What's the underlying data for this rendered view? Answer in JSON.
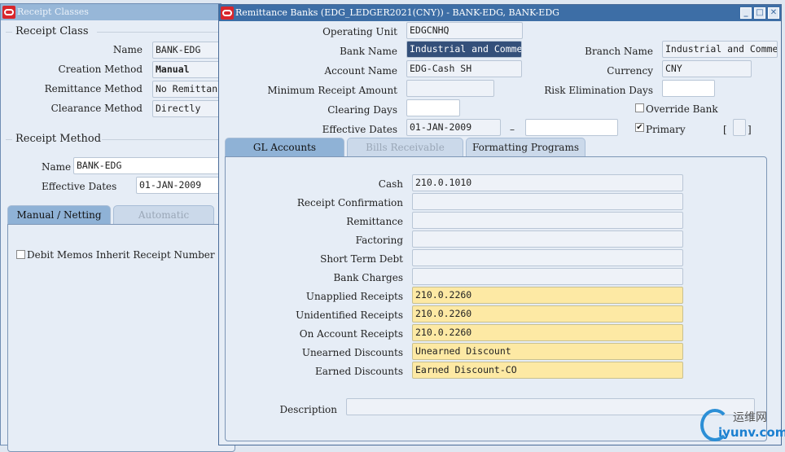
{
  "left": {
    "title": "Receipt Classes",
    "receipt_class_group": "Receipt Class",
    "name_label": "Name",
    "name_value": "BANK-EDG",
    "creation_label": "Creation Method",
    "creation_value": "Manual",
    "remit_label": "Remittance Method",
    "remit_value": "No Remittan",
    "clear_label": "Clearance Method",
    "clear_value": "Directly",
    "receipt_method_group": "Receipt Method",
    "rm_name_label": "Name",
    "rm_name_value": "BANK-EDG",
    "rm_dates_label": "Effective Dates",
    "rm_date_from": "01-JAN-2009",
    "tabs": [
      "Manual / Netting",
      "Automatic"
    ],
    "debit_memos_label": "Debit Memos Inherit Receipt Number"
  },
  "right": {
    "title": "Remittance Banks (EDG_LEDGER2021(CNY)) - BANK-EDG, BANK-EDG",
    "operating_unit_label": "Operating Unit",
    "operating_unit": "EDGCNHQ",
    "bank_name_label": "Bank Name",
    "bank_name": "Industrial and Comme",
    "branch_name_label": "Branch Name",
    "branch_name": "Industrial and Comme",
    "account_name_label": "Account Name",
    "account_name": "EDG-Cash SH",
    "currency_label": "Currency",
    "currency": "CNY",
    "min_receipt_label": "Minimum Receipt Amount",
    "min_receipt": "",
    "risk_days_label": "Risk Elimination Days",
    "risk_days": "",
    "clearing_days_label": "Clearing Days",
    "clearing_days": "",
    "override_bank_label": "Override Bank",
    "override_bank_checked": false,
    "eff_dates_label": "Effective Dates",
    "eff_from": "01-JAN-2009",
    "eff_sep": "–",
    "eff_to": "",
    "primary_label": "Primary",
    "primary_checked": true,
    "bracket_open": "[",
    "bracket_close": "]",
    "tabs": [
      "GL Accounts",
      "Bills Receivable",
      "Formatting Programs"
    ],
    "gl": [
      {
        "label": "Cash",
        "value": "210.0.1010",
        "req": false
      },
      {
        "label": "Receipt Confirmation",
        "value": "",
        "req": false
      },
      {
        "label": "Remittance",
        "value": "",
        "req": false
      },
      {
        "label": "Factoring",
        "value": "",
        "req": false
      },
      {
        "label": "Short Term Debt",
        "value": "",
        "req": false
      },
      {
        "label": "Bank Charges",
        "value": "",
        "req": false
      },
      {
        "label": "Unapplied Receipts",
        "value": "210.0.2260",
        "req": true
      },
      {
        "label": "Unidentified Receipts",
        "value": "210.0.2260",
        "req": true
      },
      {
        "label": "On Account Receipts",
        "value": "210.0.2260",
        "req": true
      },
      {
        "label": "Unearned Discounts",
        "value": "Unearned Discount",
        "req": true
      },
      {
        "label": "Earned Discounts",
        "value": "Earned Discount-CO",
        "req": true
      }
    ],
    "description_label": "Description",
    "description": ""
  },
  "watermark": {
    "cn": "运维网",
    "en": "iyunv.com"
  }
}
